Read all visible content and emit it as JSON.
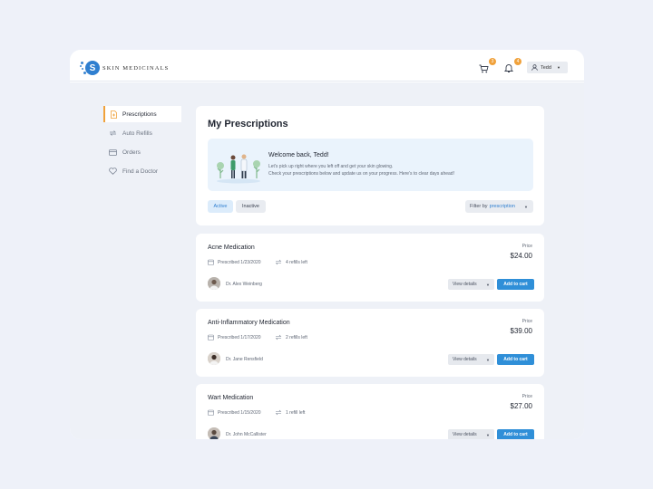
{
  "brand": {
    "name": "SKIN MEDICINALS",
    "logo_letter": "S",
    "color": "#2f7fd0"
  },
  "header": {
    "cart_count": "3",
    "notif_count": "4",
    "user_name": "Tedd"
  },
  "sidebar": {
    "items": [
      {
        "label": "Prescriptions",
        "icon": "prescription-icon",
        "active": true
      },
      {
        "label": "Auto Refills",
        "icon": "refresh-icon",
        "active": false
      },
      {
        "label": "Orders",
        "icon": "card-icon",
        "active": false
      },
      {
        "label": "Find a Doctor",
        "icon": "heart-icon",
        "active": false
      }
    ]
  },
  "main": {
    "title": "My Prescriptions",
    "welcome": {
      "title": "Welcome back, Tedd!",
      "line1": "Let's pick up right where you left off and get your skin glowing.",
      "line2": "Check your prescriptions below and update us on your progress. Here's to clear days ahead!"
    },
    "tabs": [
      {
        "label": "Active",
        "selected": true
      },
      {
        "label": "Inactive",
        "selected": false
      }
    ],
    "filter": {
      "prefix": "Filter by",
      "value": "prescription"
    }
  },
  "prescriptions": [
    {
      "name": "Acne Medication",
      "prescribed": "Prescribed 1/23/2020",
      "refills": "4 refills left",
      "price_label": "Price",
      "price": "$24.00",
      "doctor": "Dr. Alex Weinberg",
      "view_label": "View details",
      "cart_label": "Add to cart"
    },
    {
      "name": "Anti-Inflammatory Medication",
      "prescribed": "Prescribed 1/17/2020",
      "refills": "2 refills left",
      "price_label": "Price",
      "price": "$39.00",
      "doctor": "Dr. Jane Rensfield",
      "view_label": "View details",
      "cart_label": "Add to cart"
    },
    {
      "name": "Wart Medication",
      "prescribed": "Prescribed 1/15/2020",
      "refills": "1 refill left",
      "price_label": "Price",
      "price": "$27.00",
      "doctor": "Dr. John McCallister",
      "view_label": "View details",
      "cart_label": "Add to cart"
    }
  ]
}
